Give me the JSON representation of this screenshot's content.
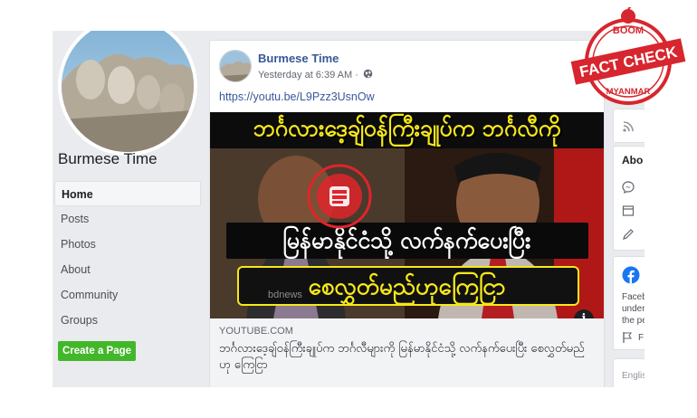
{
  "page": {
    "name": "Burmese Time",
    "nav": [
      {
        "label": "Home",
        "active": true
      },
      {
        "label": "Posts",
        "active": false
      },
      {
        "label": "Photos",
        "active": false
      },
      {
        "label": "About",
        "active": false
      },
      {
        "label": "Community",
        "active": false
      },
      {
        "label": "Groups",
        "active": false
      }
    ],
    "create_page_label": "Create a Page"
  },
  "post": {
    "author": "Burmese Time",
    "time": "Yesterday at 6:39 AM · ",
    "link": "https://youtu.be/L9Pzz3UsnOw",
    "thumbnail": {
      "line1": "ဘင်္ဂလားဒေ့ချ်ဝန်ကြီးချုပ်က ဘင်္ဂလီကို",
      "line2": "မြန်မာနိုင်ငံသို့ လက်နက်ပေးပြီး",
      "line3": "စေလွှတ်မည်ဟုကြေငြာ",
      "watermark": "bdnews"
    },
    "preview_domain": "YOUTUBE.COM",
    "preview_title": "ဘင်္ဂလားဒေ့ချ်ဝန်ကြီးချုပ်က ဘင်္ဂလီများကို မြန်မာနိုင်ငံသို့ လက်နက်ပေးပြီး စေလွှတ်မည်ဟု ကြေငြာ"
  },
  "right_column": {
    "about_heading": "Abo",
    "facebook_text": [
      "Faceb",
      "under",
      "the pe"
    ],
    "flag_label": "F",
    "language_text": "Englis"
  },
  "stamp": {
    "top": "BOOM",
    "middle": "FACT CHECK",
    "bottom": "MYANMAR",
    "colors": {
      "red": "#d7262e"
    }
  },
  "icons": {
    "globe": "globe-icon",
    "info": "info-icon",
    "messenger": "messenger-icon",
    "window": "window-icon",
    "pencil": "pencil-icon",
    "facebook": "facebook-icon",
    "flag": "flag-icon",
    "rss": "rss-icon"
  }
}
